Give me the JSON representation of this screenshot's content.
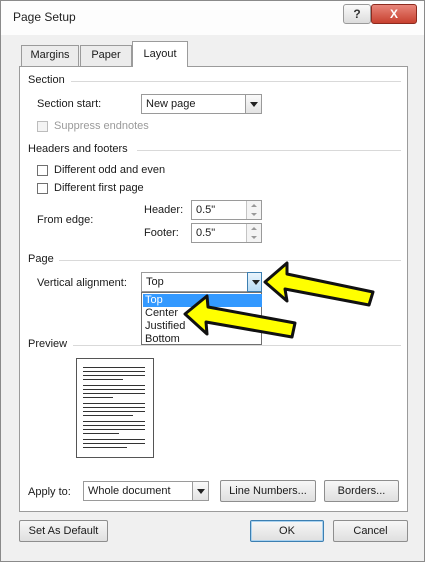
{
  "window": {
    "title": "Page Setup",
    "help_label": "?",
    "close_label": "X"
  },
  "tabs": [
    {
      "label": "Margins"
    },
    {
      "label": "Paper"
    },
    {
      "label": "Layout"
    }
  ],
  "section": {
    "heading": "Section",
    "start_label": "Section start:",
    "start_value": "New page",
    "suppress_label": "Suppress endnotes"
  },
  "headers_footers": {
    "heading": "Headers and footers",
    "odd_even_label": "Different odd and even",
    "first_page_label": "Different first page",
    "from_edge_label": "From edge:",
    "header_label": "Header:",
    "header_value": "0.5\"",
    "footer_label": "Footer:",
    "footer_value": "0.5\""
  },
  "page": {
    "heading": "Page",
    "valign_label": "Vertical alignment:",
    "valign_value": "Top",
    "options": [
      "Top",
      "Center",
      "Justified",
      "Bottom"
    ]
  },
  "preview": {
    "heading": "Preview"
  },
  "apply": {
    "label": "Apply to:",
    "value": "Whole document"
  },
  "buttons": {
    "line_numbers": "Line Numbers...",
    "borders": "Borders...",
    "set_default": "Set As Default",
    "ok": "OK",
    "cancel": "Cancel"
  },
  "colors": {
    "highlight": "#3399ff",
    "arrow": "#ffff00"
  }
}
